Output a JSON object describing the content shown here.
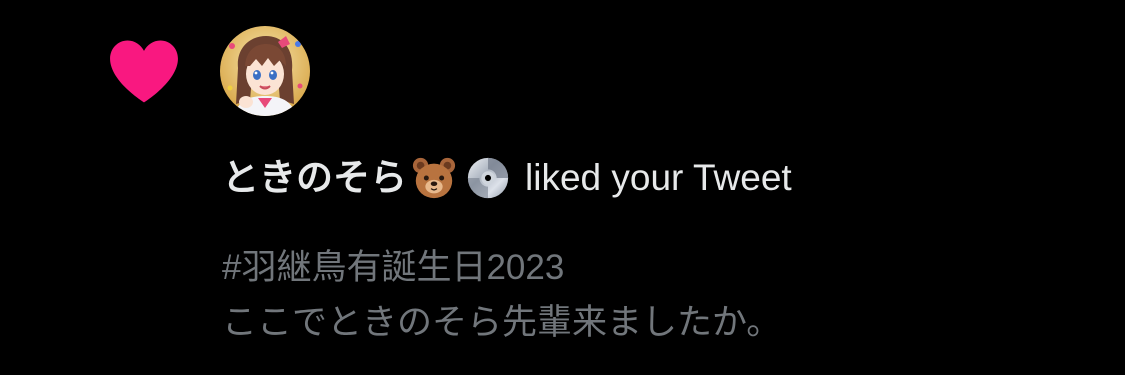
{
  "notification": {
    "type_icon": "heart-icon",
    "heart_color": "#f91880",
    "user": {
      "display_name": "ときのそら",
      "emojis": [
        "bear-face-icon",
        "optical-disc-icon"
      ],
      "avatar": "user-avatar"
    },
    "action": "liked your Tweet",
    "tweet_lines": [
      "#羽継鳥有誕生日2023",
      "ここでときのそら先輩来ましたか。"
    ]
  },
  "colors": {
    "background": "#000000",
    "primary_text": "#e7e9ea",
    "secondary_text": "#71767b"
  }
}
